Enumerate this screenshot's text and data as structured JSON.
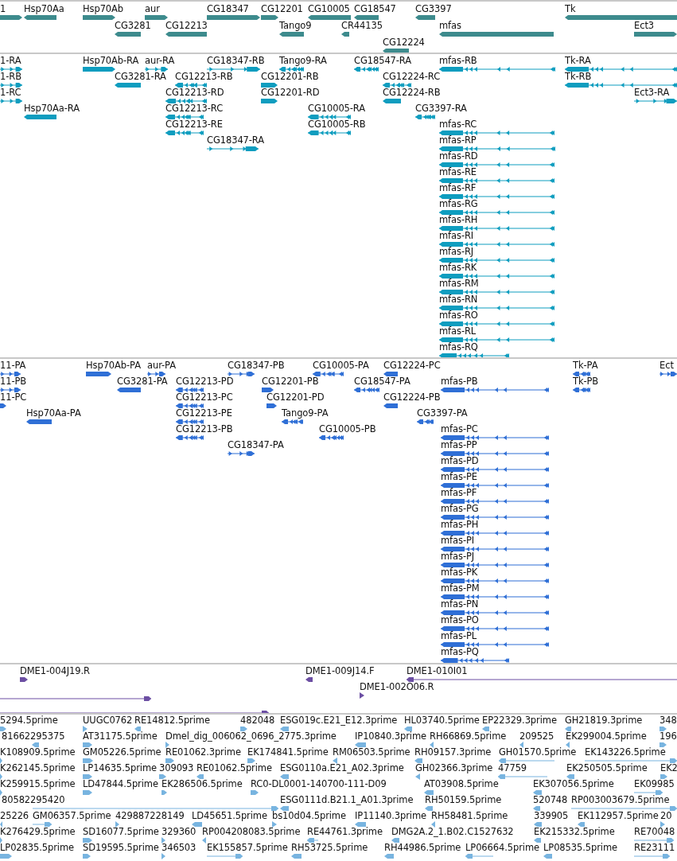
{
  "tracks": [
    {
      "kind": "gene",
      "color": "#3d8b8d",
      "features": [
        {
          "label": "1",
          "reverse": false
        },
        {
          "label": "Hsp70Aa",
          "reverse": true
        },
        {
          "label": "Hsp70Ab",
          "reverse": false
        },
        {
          "label": "aur",
          "reverse": false
        },
        {
          "label": "CG18347",
          "reverse": false
        },
        {
          "label": "CG12201",
          "reverse": false
        },
        {
          "label": "CG10005",
          "reverse": true
        },
        {
          "label": "CG18547",
          "reverse": true
        },
        {
          "label": "CG3397",
          "reverse": true
        },
        {
          "label": "Tk",
          "reverse": true
        },
        {
          "label": "CG3281",
          "reverse": true
        },
        {
          "label": "CG12213",
          "reverse": true
        },
        {
          "label": "Tango9",
          "reverse": true
        },
        {
          "label": "CR44135",
          "reverse": true
        },
        {
          "label": "mfas",
          "reverse": true
        },
        {
          "label": "Ect3",
          "reverse": false
        },
        {
          "label": "CG12224",
          "reverse": true
        }
      ]
    },
    {
      "kind": "transcript",
      "color": "#0e9dbf",
      "features": [
        {
          "label": "1-RA",
          "reverse": false
        },
        {
          "label": "Hsp70Ab-RA",
          "reverse": false
        },
        {
          "label": "aur-RA",
          "reverse": false
        },
        {
          "label": "CG18347-RB",
          "reverse": false
        },
        {
          "label": "Tango9-RA",
          "reverse": true
        },
        {
          "label": "CG18547-RA",
          "reverse": true
        },
        {
          "label": "mfas-RB",
          "reverse": true
        },
        {
          "label": "Tk-RA",
          "reverse": true
        },
        {
          "label": "1-RB",
          "reverse": false
        },
        {
          "label": "CG3281-RA",
          "reverse": true
        },
        {
          "label": "CG12213-RB",
          "reverse": true
        },
        {
          "label": "CG12201-RB",
          "reverse": false
        },
        {
          "label": "CG12224-RC",
          "reverse": true
        },
        {
          "label": "Tk-RB",
          "reverse": true
        },
        {
          "label": "1-RC",
          "reverse": false
        },
        {
          "label": "CG12213-RD",
          "reverse": true
        },
        {
          "label": "CG12201-RD",
          "reverse": false
        },
        {
          "label": "CG12224-RB",
          "reverse": true
        },
        {
          "label": "Ect3-RA",
          "reverse": false
        },
        {
          "label": "Hsp70Aa-RA",
          "reverse": true
        },
        {
          "label": "CG12213-RC",
          "reverse": true
        },
        {
          "label": "CG10005-RA",
          "reverse": true
        },
        {
          "label": "CG3397-RA",
          "reverse": true
        },
        {
          "label": "CG12213-RE",
          "reverse": true
        },
        {
          "label": "CG10005-RB",
          "reverse": true
        },
        {
          "label": "mfas-RC",
          "reverse": true
        },
        {
          "label": "CG18347-RA",
          "reverse": false
        },
        {
          "label": "mfas-RP",
          "reverse": true
        },
        {
          "label": "mfas-RD",
          "reverse": true
        },
        {
          "label": "mfas-RE",
          "reverse": true
        },
        {
          "label": "mfas-RF",
          "reverse": true
        },
        {
          "label": "mfas-RG",
          "reverse": true
        },
        {
          "label": "mfas-RH",
          "reverse": true
        },
        {
          "label": "mfas-RI",
          "reverse": true
        },
        {
          "label": "mfas-RJ",
          "reverse": true
        },
        {
          "label": "mfas-RK",
          "reverse": true
        },
        {
          "label": "mfas-RM",
          "reverse": true
        },
        {
          "label": "mfas-RN",
          "reverse": true
        },
        {
          "label": "mfas-RO",
          "reverse": true
        },
        {
          "label": "mfas-RL",
          "reverse": true
        },
        {
          "label": "mfas-RQ",
          "reverse": true
        }
      ]
    },
    {
      "kind": "protein",
      "color": "#2f6fd6",
      "features": [
        {
          "label": "11-PA",
          "reverse": false
        },
        {
          "label": "Hsp70Ab-PA",
          "reverse": false
        },
        {
          "label": "aur-PA",
          "reverse": false
        },
        {
          "label": "CG18347-PB",
          "reverse": false
        },
        {
          "label": "CG10005-PA",
          "reverse": true
        },
        {
          "label": "CG12224-PC",
          "reverse": true
        },
        {
          "label": "Tk-PA",
          "reverse": true
        },
        {
          "label": "Ect",
          "reverse": false
        },
        {
          "label": "11-PB",
          "reverse": false
        },
        {
          "label": "CG3281-PA",
          "reverse": true
        },
        {
          "label": "CG12213-PD",
          "reverse": true
        },
        {
          "label": "CG12201-PB",
          "reverse": false
        },
        {
          "label": "CG18547-PA",
          "reverse": true
        },
        {
          "label": "mfas-PB",
          "reverse": true
        },
        {
          "label": "Tk-PB",
          "reverse": true
        },
        {
          "label": "11-PC",
          "reverse": false
        },
        {
          "label": "CG12213-PC",
          "reverse": true
        },
        {
          "label": "CG12201-PD",
          "reverse": false
        },
        {
          "label": "CG12224-PB",
          "reverse": true
        },
        {
          "label": "Hsp70Aa-PA",
          "reverse": true
        },
        {
          "label": "CG12213-PE",
          "reverse": true
        },
        {
          "label": "Tango9-PA",
          "reverse": true
        },
        {
          "label": "CG3397-PA",
          "reverse": true
        },
        {
          "label": "CG12213-PB",
          "reverse": true
        },
        {
          "label": "CG10005-PB",
          "reverse": true
        },
        {
          "label": "mfas-PC",
          "reverse": true
        },
        {
          "label": "CG18347-PA",
          "reverse": false
        },
        {
          "label": "mfas-PP",
          "reverse": true
        },
        {
          "label": "mfas-PD",
          "reverse": true
        },
        {
          "label": "mfas-PE",
          "reverse": true
        },
        {
          "label": "mfas-PF",
          "reverse": true
        },
        {
          "label": "mfas-PG",
          "reverse": true
        },
        {
          "label": "mfas-PH",
          "reverse": true
        },
        {
          "label": "mfas-PI",
          "reverse": true
        },
        {
          "label": "mfas-PJ",
          "reverse": true
        },
        {
          "label": "mfas-PK",
          "reverse": true
        },
        {
          "label": "mfas-PM",
          "reverse": true
        },
        {
          "label": "mfas-PN",
          "reverse": true
        },
        {
          "label": "mfas-PO",
          "reverse": true
        },
        {
          "label": "mfas-PL",
          "reverse": true
        },
        {
          "label": "mfas-PQ",
          "reverse": true
        }
      ]
    },
    {
      "kind": "bac_end",
      "color": "#6c4fa3",
      "features": [
        {
          "label": "DME1-004J19.R",
          "reverse": false
        },
        {
          "label": "DME1-009J14.F",
          "reverse": true
        },
        {
          "label": "DME1-010I01",
          "reverse": true
        },
        {
          "label": "DME1-002O06.R",
          "reverse": false
        },
        {
          "reverse": false
        },
        {
          "reverse": false
        }
      ]
    },
    {
      "kind": "est",
      "color": "#78b4e0",
      "features": [
        {
          "label": "5294.5prime",
          "reverse": false
        },
        {
          "label": "UUGC0762",
          "reverse": false
        },
        {
          "label": "RE14812.5prime",
          "reverse": true
        },
        {
          "label": "482048",
          "reverse": false
        },
        {
          "label": "ESG019c.E21_E12.3prime",
          "reverse": true
        },
        {
          "label": "HL03740.5prime",
          "reverse": true
        },
        {
          "label": "EP22329.3prime",
          "reverse": true
        },
        {
          "label": "GH21819.3prime",
          "reverse": true
        },
        {
          "label": "348",
          "reverse": false
        },
        {
          "label": "81662295375",
          "reverse": true
        },
        {
          "label": "AT31175.5prime",
          "reverse": false
        },
        {
          "label": "Dmel_dig_006062_0696_2775.3prime",
          "reverse": false
        },
        {
          "label": "IP10840.3prime",
          "reverse": true
        },
        {
          "label": "RH66869.5prime",
          "reverse": true
        },
        {
          "label": "209525",
          "reverse": true
        },
        {
          "label": "EK299004.5prime",
          "reverse": true
        },
        {
          "label": "196",
          "reverse": false
        },
        {
          "label": "K108909.5prime",
          "reverse": false
        },
        {
          "label": "GM05226.5prime",
          "reverse": false
        },
        {
          "label": "RE01062.3prime",
          "reverse": false
        },
        {
          "label": "EK174841.5prime",
          "reverse": false
        },
        {
          "label": "RM06503.5prime",
          "reverse": true
        },
        {
          "label": "RH09157.3prime",
          "reverse": true
        },
        {
          "label": "GH01570.5prime",
          "reverse": true
        },
        {
          "label": "EK143226.5prime",
          "reverse": false
        },
        {
          "label": "K262145.5prime",
          "reverse": false
        },
        {
          "label": "LP14635.5prime",
          "reverse": false
        },
        {
          "label": "309093",
          "reverse": false
        },
        {
          "label": "RE01062.5prime",
          "reverse": true
        },
        {
          "label": "ESG0110a.E21_A02.3prime",
          "reverse": true
        },
        {
          "label": "GH02366.3prime",
          "reverse": true
        },
        {
          "label": "47759",
          "reverse": true
        },
        {
          "label": "EK250505.5prime",
          "reverse": true
        },
        {
          "label": "EK2",
          "reverse": false
        },
        {
          "label": "K259915.5prime",
          "reverse": false
        },
        {
          "label": "LD47844.5prime",
          "reverse": false
        },
        {
          "label": "EK286506.5prime",
          "reverse": false
        },
        {
          "label": "RC0-DL0001-140700-111-D09",
          "reverse": false
        },
        {
          "label": "AT03908.5prime",
          "reverse": true
        },
        {
          "label": "EK307056.5prime",
          "reverse": true
        },
        {
          "label": "EK09985",
          "reverse": false
        },
        {
          "label": "80582295420",
          "reverse": false
        },
        {
          "label": "ESG0111d.B21.1_A01.3prime",
          "reverse": true
        },
        {
          "label": "RH50159.5prime",
          "reverse": true
        },
        {
          "label": "520748",
          "reverse": true
        },
        {
          "label": "RP003003679.5prime",
          "reverse": false
        },
        {
          "label": "25226",
          "reverse": true
        },
        {
          "label": "GM06357.5prime",
          "reverse": false
        },
        {
          "label": "429887228149",
          "reverse": false
        },
        {
          "label": "LD45651.5prime",
          "reverse": true
        },
        {
          "label": "bs10d04.5prime",
          "reverse": false
        },
        {
          "label": "IP11140.3prime",
          "reverse": true
        },
        {
          "label": "RH58481.5prime",
          "reverse": true
        },
        {
          "label": "339905",
          "reverse": true
        },
        {
          "label": "EK112957.5prime",
          "reverse": true
        },
        {
          "label": "20",
          "reverse": false
        },
        {
          "label": "K276429.5prime",
          "reverse": false
        },
        {
          "label": "SD16077.5prime",
          "reverse": false
        },
        {
          "label": "329360",
          "reverse": false
        },
        {
          "label": "RP004208083.5prime",
          "reverse": true
        },
        {
          "label": "RE44761.3prime",
          "reverse": true
        },
        {
          "label": "DMG2A.2_1.B02.C1527632",
          "reverse": true
        },
        {
          "label": "EK215332.5prime",
          "reverse": true
        },
        {
          "label": "RE70048",
          "reverse": false
        },
        {
          "label": "LP02835.5prime",
          "reverse": false
        },
        {
          "label": "SD19595.5prime",
          "reverse": false
        },
        {
          "label": "346503",
          "reverse": false
        },
        {
          "label": "EK155857.5prime",
          "reverse": false
        },
        {
          "label": "RH53725.5prime",
          "reverse": true
        },
        {
          "label": "RH44986.5prime",
          "reverse": true
        },
        {
          "label": "LP06664.5prime",
          "reverse": true
        },
        {
          "label": "LP08535.5prime",
          "reverse": true
        },
        {
          "label": "RE23111",
          "reverse": false
        }
      ]
    }
  ]
}
